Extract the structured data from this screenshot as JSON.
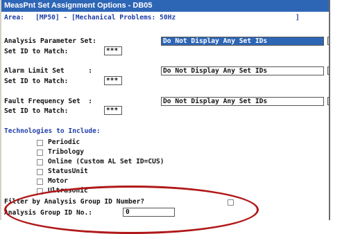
{
  "window": {
    "title": "MeasPnt Set Assignment Options - DB05"
  },
  "area": {
    "label": "Area:",
    "value": "[MP50] - [Mechanical Problems: 50Hz",
    "close": "]"
  },
  "analysis_parameter_set": {
    "label": "Analysis Parameter Set:",
    "selected": "Do Not Display Any Set IDs",
    "match_label": "Set ID to Match:",
    "match_value": "***"
  },
  "alarm_limit_set": {
    "label": "Alarm Limit Set      :",
    "selected": "Do Not Display Any Set IDs",
    "match_label": "Set ID to Match:",
    "match_value": "***"
  },
  "fault_frequency_set": {
    "label": "Fault Frequency Set  :",
    "selected": "Do Not Display Any Set IDs",
    "match_label": "Set ID to Match:",
    "match_value": "***"
  },
  "technologies": {
    "heading": "Technologies to Include:",
    "items": [
      {
        "label": "Periodic",
        "checked": false
      },
      {
        "label": "Tribology",
        "checked": false
      },
      {
        "label": "Online (Custom AL Set ID=CUS)",
        "checked": false
      },
      {
        "label": "StatusUnit",
        "checked": false
      },
      {
        "label": "Motor",
        "checked": false
      },
      {
        "label": "Ultrasonic",
        "checked": false
      }
    ]
  },
  "filter": {
    "label": "Filter by Analysis Group ID Number?",
    "checked": false
  },
  "group_id": {
    "label": "Analysis Group ID No.:",
    "value": "0"
  },
  "colors": {
    "titlebar": "#2e66b6",
    "label_blue": "#1f3ea8",
    "annotation_red": "#b01818"
  }
}
